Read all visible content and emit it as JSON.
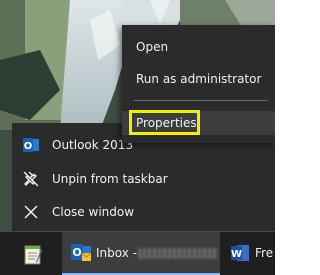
{
  "context_menu": {
    "items": [
      {
        "label": "Open"
      },
      {
        "label": "Run as administrator"
      },
      {
        "label": "Properties"
      }
    ],
    "highlight_color": "#f2f200"
  },
  "jump_list": {
    "items": [
      {
        "label": "Outlook 2013",
        "icon": "outlook-icon"
      },
      {
        "label": "Unpin from taskbar",
        "icon": "unpin-icon"
      },
      {
        "label": "Close window",
        "icon": "close-icon"
      }
    ]
  },
  "taskbar": {
    "buttons": [
      {
        "label": "",
        "icon": "notepad-icon"
      },
      {
        "label": "Inbox -",
        "icon": "outlook-icon"
      },
      {
        "label": "Fre",
        "icon": "word-icon"
      }
    ],
    "active_accent": "#8ab4f8"
  }
}
